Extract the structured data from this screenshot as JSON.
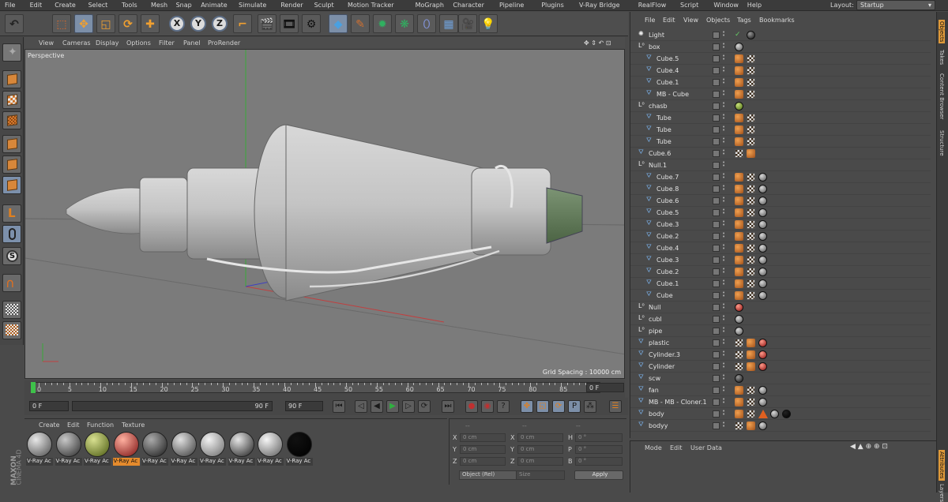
{
  "app": {
    "layout_label": "Layout:",
    "layout_value": "Startup"
  },
  "menu": [
    "File",
    "Edit",
    "Create",
    "Select",
    "Tools",
    "Mesh",
    "Snap",
    "Animate",
    "Simulate",
    "Render",
    "Sculpt",
    "Motion Tracker",
    "MoGraph",
    "Character",
    "Pipeline",
    "Plugins",
    "V-Ray Bridge",
    "RealFlow",
    "Script",
    "Window",
    "Help"
  ],
  "toolbar": {
    "axis_x": "X",
    "axis_y": "Y",
    "axis_z": "Z",
    "icons": [
      "undo-icon",
      "live-selection-icon",
      "move-icon",
      "scale-icon",
      "rotate-icon",
      "add-icon",
      "x-axis-icon",
      "y-axis-icon",
      "z-axis-icon",
      "coordinate-system-icon",
      "render-view-icon",
      "render-picture-viewer-icon",
      "edit-render-settings-icon",
      "cube-primitive-icon",
      "pen-spline-icon",
      "subdivision-icon",
      "array-icon",
      "deformer-icon",
      "floor-icon",
      "camera-icon",
      "light-icon"
    ]
  },
  "viewport": {
    "menu": [
      "View",
      "Cameras",
      "Display",
      "Options",
      "Filter",
      "Panel",
      "ProRender"
    ],
    "camera_label": "Perspective",
    "grid_spacing": "Grid Spacing : 10000 cm"
  },
  "timeline": {
    "ticks": [
      "0",
      "5",
      "10",
      "15",
      "20",
      "25",
      "30",
      "35",
      "40",
      "45",
      "50",
      "55",
      "60",
      "65",
      "70",
      "75",
      "80",
      "85",
      "90"
    ],
    "end_field": "0 F",
    "current_frame": "0 F",
    "range_start": "0 F",
    "range_end": "90 F",
    "range_end2": "90 F"
  },
  "materials": {
    "menu": [
      "Create",
      "Edit",
      "Function",
      "Texture"
    ],
    "items": [
      {
        "label": "V-Ray Ac",
        "color_a": "#e8e8e8",
        "color_b": "#4a4a4a"
      },
      {
        "label": "V-Ray Ac",
        "color_a": "#c8c8c8",
        "color_b": "#2a2a2a"
      },
      {
        "label": "V-Ray Ac",
        "color_a": "#d8e090",
        "color_b": "#4a5a10"
      },
      {
        "label": "V-Ray Ac",
        "color_a": "#ffb0a0",
        "color_b": "#7a1010",
        "selected": true
      },
      {
        "label": "V-Ray Ac",
        "color_a": "#aaaaaa",
        "color_b": "#1a1a1a"
      },
      {
        "label": "V-Ray Ac",
        "color_a": "#e0e0e0",
        "color_b": "#3a3a3a"
      },
      {
        "label": "V-Ray Ac",
        "color_a": "#f2f2f2",
        "color_b": "#6a6a6a"
      },
      {
        "label": "V-Ray Ac",
        "color_a": "#e6e6e6",
        "color_b": "#1e1e1e"
      },
      {
        "label": "V-Ray Ac",
        "color_a": "#f6f6f6",
        "color_b": "#5a5a5a"
      },
      {
        "label": "V-Ray Ac",
        "color_a": "#111111",
        "color_b": "#000000"
      }
    ]
  },
  "brand": {
    "line1": "MAXON",
    "line2": "CINEMA 4D"
  },
  "coords": {
    "header_dash1": "--",
    "header_dash2": "--",
    "header_dash3": "--",
    "rows": [
      {
        "a": "X",
        "av": "0 cm",
        "b": "X",
        "bv": "0 cm",
        "c": "H",
        "cv": "0 °"
      },
      {
        "a": "Y",
        "av": "0 cm",
        "b": "Y",
        "bv": "0 cm",
        "c": "P",
        "cv": "0 °"
      },
      {
        "a": "Z",
        "av": "0 cm",
        "b": "Z",
        "bv": "0 cm",
        "c": "B",
        "cv": "0 °"
      }
    ],
    "mode": "Object (Rel)",
    "size": "Size",
    "apply": "Apply"
  },
  "objects": {
    "menu": [
      "File",
      "Edit",
      "View",
      "Objects",
      "Tags",
      "Bookmarks"
    ],
    "rows": [
      {
        "name": "Light",
        "indent": 0,
        "type": "light"
      },
      {
        "name": "box",
        "indent": 0,
        "type": "null"
      },
      {
        "name": "Cube.5",
        "indent": 1,
        "type": "poly"
      },
      {
        "name": "Cube.4",
        "indent": 1,
        "type": "poly"
      },
      {
        "name": "Cube.1",
        "indent": 1,
        "type": "poly"
      },
      {
        "name": "MB - Cube",
        "indent": 1,
        "type": "poly"
      },
      {
        "name": "chasb",
        "indent": 0,
        "type": "null"
      },
      {
        "name": "Tube",
        "indent": 1,
        "type": "poly"
      },
      {
        "name": "Tube",
        "indent": 1,
        "type": "poly"
      },
      {
        "name": "Tube",
        "indent": 1,
        "type": "poly"
      },
      {
        "name": "Cube.6",
        "indent": 0,
        "type": "poly"
      },
      {
        "name": "Null.1",
        "indent": 0,
        "type": "null"
      },
      {
        "name": "Cube.7",
        "indent": 1,
        "type": "poly"
      },
      {
        "name": "Cube.8",
        "indent": 1,
        "type": "poly"
      },
      {
        "name": "Cube.6",
        "indent": 1,
        "type": "poly"
      },
      {
        "name": "Cube.5",
        "indent": 1,
        "type": "poly"
      },
      {
        "name": "Cube.3",
        "indent": 1,
        "type": "poly"
      },
      {
        "name": "Cube.2",
        "indent": 1,
        "type": "poly"
      },
      {
        "name": "Cube.4",
        "indent": 1,
        "type": "poly"
      },
      {
        "name": "Cube.3",
        "indent": 1,
        "type": "poly"
      },
      {
        "name": "Cube.2",
        "indent": 1,
        "type": "poly"
      },
      {
        "name": "Cube.1",
        "indent": 1,
        "type": "poly"
      },
      {
        "name": "Cube",
        "indent": 1,
        "type": "poly"
      },
      {
        "name": "Null",
        "indent": 0,
        "type": "null"
      },
      {
        "name": "cubl",
        "indent": 0,
        "type": "null"
      },
      {
        "name": "pipe",
        "indent": 0,
        "type": "null"
      },
      {
        "name": "plastic",
        "indent": 0,
        "type": "poly"
      },
      {
        "name": "Cylinder.3",
        "indent": 0,
        "type": "poly"
      },
      {
        "name": "Cylinder",
        "indent": 0,
        "type": "poly"
      },
      {
        "name": "scw",
        "indent": 0,
        "type": "poly"
      },
      {
        "name": "fan",
        "indent": 0,
        "type": "poly"
      },
      {
        "name": "MB - MB - Cloner.1",
        "indent": 0,
        "type": "poly"
      },
      {
        "name": "body",
        "indent": 0,
        "type": "poly"
      },
      {
        "name": "bodyy",
        "indent": 0,
        "type": "poly"
      }
    ]
  },
  "attributes": {
    "menu": [
      "Mode",
      "Edit",
      "User Data"
    ]
  },
  "side_tabs": [
    "Objects",
    "Takes",
    "Content Browser",
    "Structure"
  ],
  "side_tabs_bottom": [
    "Attributes",
    "Layers"
  ]
}
